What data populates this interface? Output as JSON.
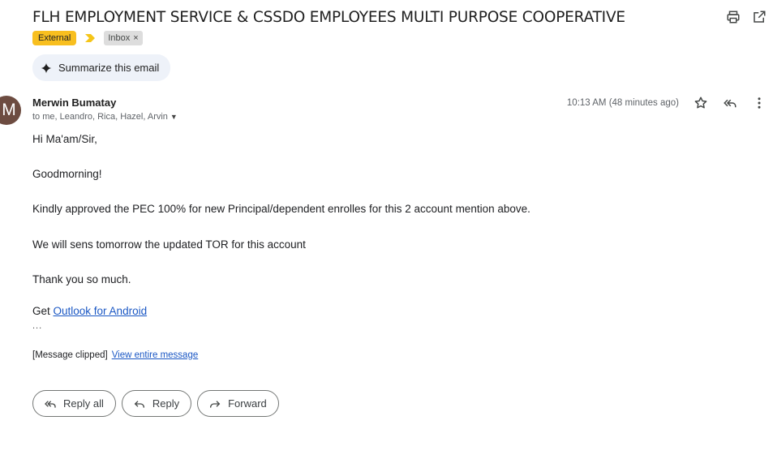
{
  "email": {
    "subject": "FLH EMPLOYMENT SERVICE & CSSDO EMPLOYEES MULTI PURPOSE COOPERATIVE",
    "labels": {
      "external": "External",
      "inbox": "Inbox",
      "inbox_remove": "×"
    },
    "summarize_label": "Summarize this email",
    "sender": {
      "initial": "M",
      "name": "Merwin Bumatay",
      "recipients": "to me, Leandro, Rica, Hazel, Arvin",
      "avatar_color": "#6d4c41"
    },
    "timestamp": "10:13 AM (48 minutes ago)",
    "body": {
      "greeting": "Hi Ma'am/Sir,",
      "line2": "Goodmorning!",
      "line3": "Kindly approved the PEC 100% for new Principal/dependent enrolles for this 2 account mention above.",
      "line4": "We will sens tomorrow the updated TOR for this account",
      "line5": "Thank you so much.",
      "get_prefix": "Get ",
      "get_link": "Outlook for Android",
      "ellipsis": "..."
    },
    "clipped": {
      "text": "[Message clipped]",
      "link": "View entire message"
    },
    "actions": {
      "reply_all": "Reply all",
      "reply": "Reply",
      "forward": "Forward"
    }
  },
  "icons": {
    "print": "print-icon",
    "open_new": "open-in-new-window-icon",
    "importance": "importance-marker-icon",
    "sparkle": "sparkle-icon",
    "star": "star-icon",
    "reply_all": "reply-all-icon",
    "more": "more-vertical-icon",
    "reply": "reply-icon",
    "forward": "forward-icon"
  },
  "colors": {
    "external_tag": "#f8bf1f",
    "link": "#1a57c4",
    "summarize_bg": "#eef2f9"
  }
}
